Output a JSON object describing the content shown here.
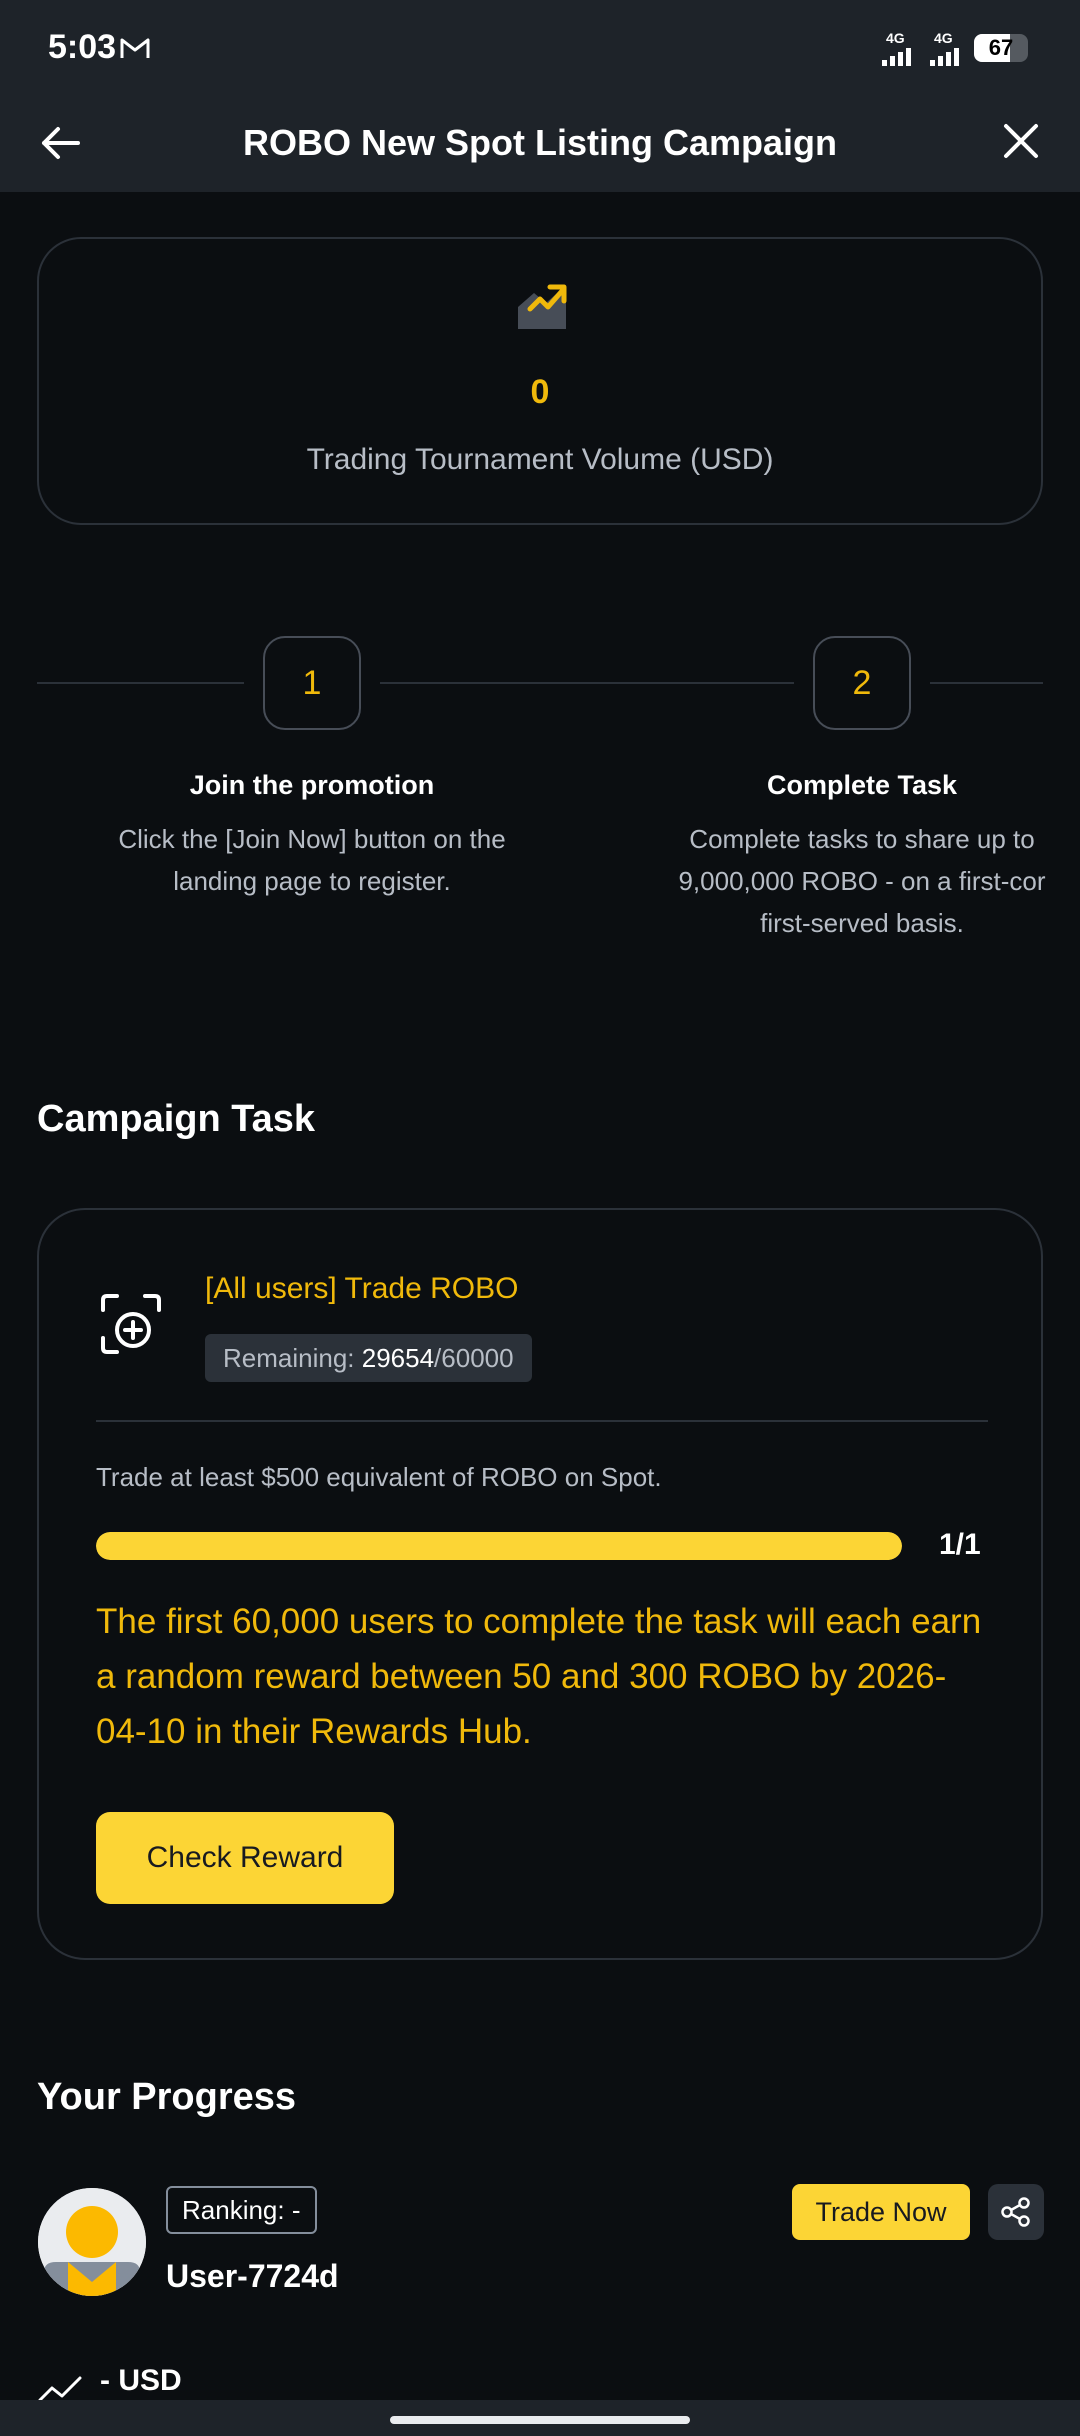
{
  "status_bar": {
    "time": "5:03",
    "signal_1_label": "4G",
    "signal_2_label": "4G",
    "battery_percent": 67,
    "battery_label": "67"
  },
  "header": {
    "title": "ROBO New Spot Listing Campaign"
  },
  "volume_card": {
    "value": "0",
    "label": "Trading Tournament Volume (USD)"
  },
  "steps": [
    {
      "number": "1",
      "title": "Join the promotion",
      "description": "Click the [Join Now] button on the landing page to register."
    },
    {
      "number": "2",
      "title": "Complete Task",
      "description": "Complete tasks to share up to\n9,000,000 ROBO - on a first-cor\nfirst-served basis."
    }
  ],
  "campaign_task": {
    "section_title": "Campaign Task",
    "task_title": "[All users] Trade ROBO",
    "remaining_label": "Remaining: ",
    "remaining_current": "29654",
    "remaining_total": "/60000",
    "requirement": "Trade at least $500 equivalent of ROBO on Spot.",
    "progress_fraction": 1.0,
    "progress_text": "1/1",
    "note": "The first 60,000 users to complete the task will each earn a random reward between 50 and 300 ROBO by 2026-04-10 in their Rewards Hub.",
    "button_label": "Check Reward"
  },
  "your_progress": {
    "section_title": "Your Progress",
    "ranking_label": "Ranking: -",
    "username": "User-7724d",
    "trade_button_label": "Trade Now",
    "usd_value": "- USD"
  },
  "colors": {
    "accent": "#f0b90b",
    "button_yellow": "#fcd535",
    "background": "#0b0e11",
    "header_bg": "#1e2329",
    "border": "#2b3139",
    "secondary_text": "#b7bdc6"
  },
  "icons": {
    "back": "arrow-left-icon",
    "close": "close-icon",
    "volume": "trend-up-chart-icon",
    "task": "target-scan-icon",
    "share": "share-icon",
    "trend": "trend-line-icon"
  }
}
